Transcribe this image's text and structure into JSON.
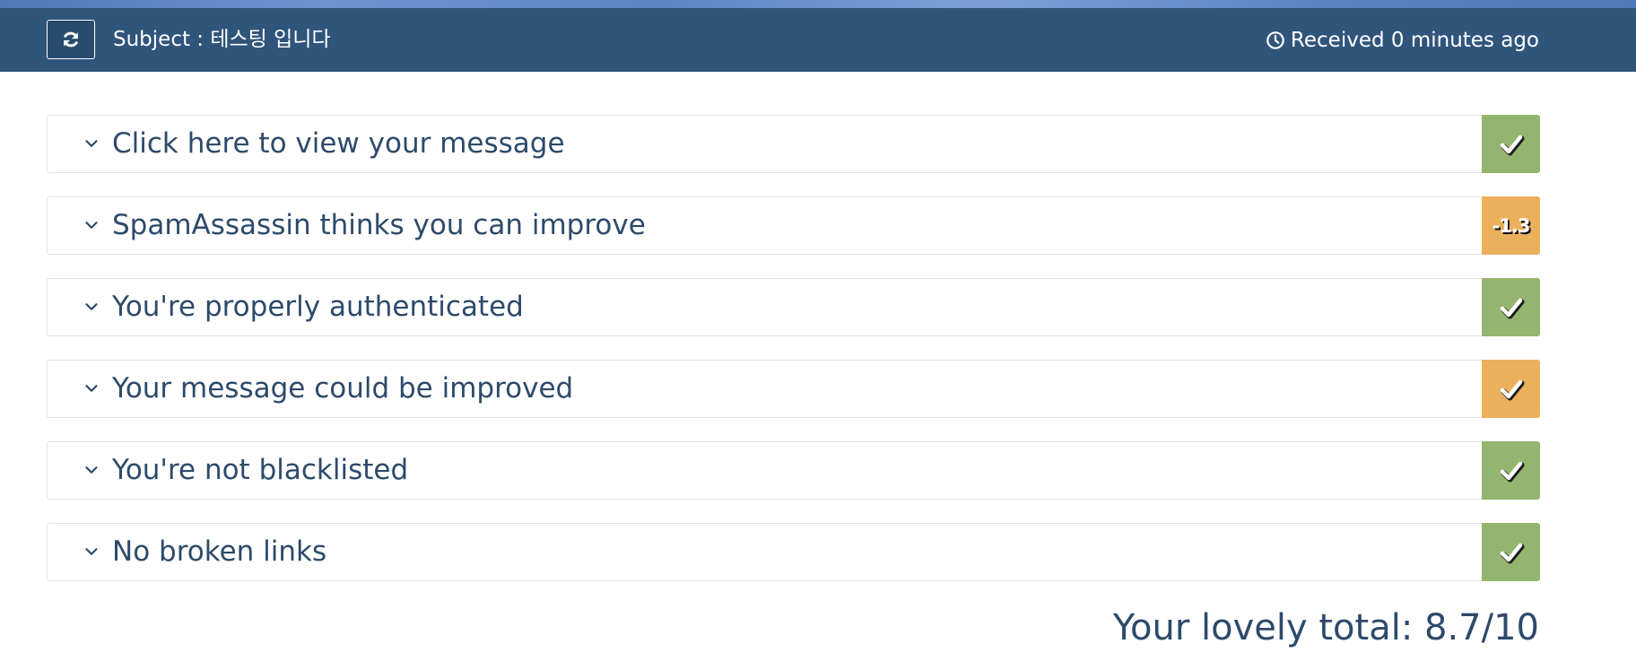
{
  "header": {
    "refresh_icon": "refresh-icon",
    "subject": "Subject : 테스팅 입니다",
    "received": "Received 0 minutes ago",
    "clock_icon": "clock-icon"
  },
  "colors": {
    "header_bg": "#30557b",
    "text": "#2d4a6b",
    "pass_green": "#94b56f",
    "warn_orange": "#ebb05c"
  },
  "checks": [
    {
      "title": "Click here to view your message",
      "status": "pass",
      "score": ""
    },
    {
      "title": "SpamAssassin thinks you can improve",
      "status": "warn",
      "score": "-1.3"
    },
    {
      "title": "You're properly authenticated",
      "status": "pass",
      "score": ""
    },
    {
      "title": "Your message could be improved",
      "status": "warn",
      "score": ""
    },
    {
      "title": "You're not blacklisted",
      "status": "pass",
      "score": ""
    },
    {
      "title": "No broken links",
      "status": "pass",
      "score": ""
    }
  ],
  "total": "Your lovely total: 8.7/10"
}
